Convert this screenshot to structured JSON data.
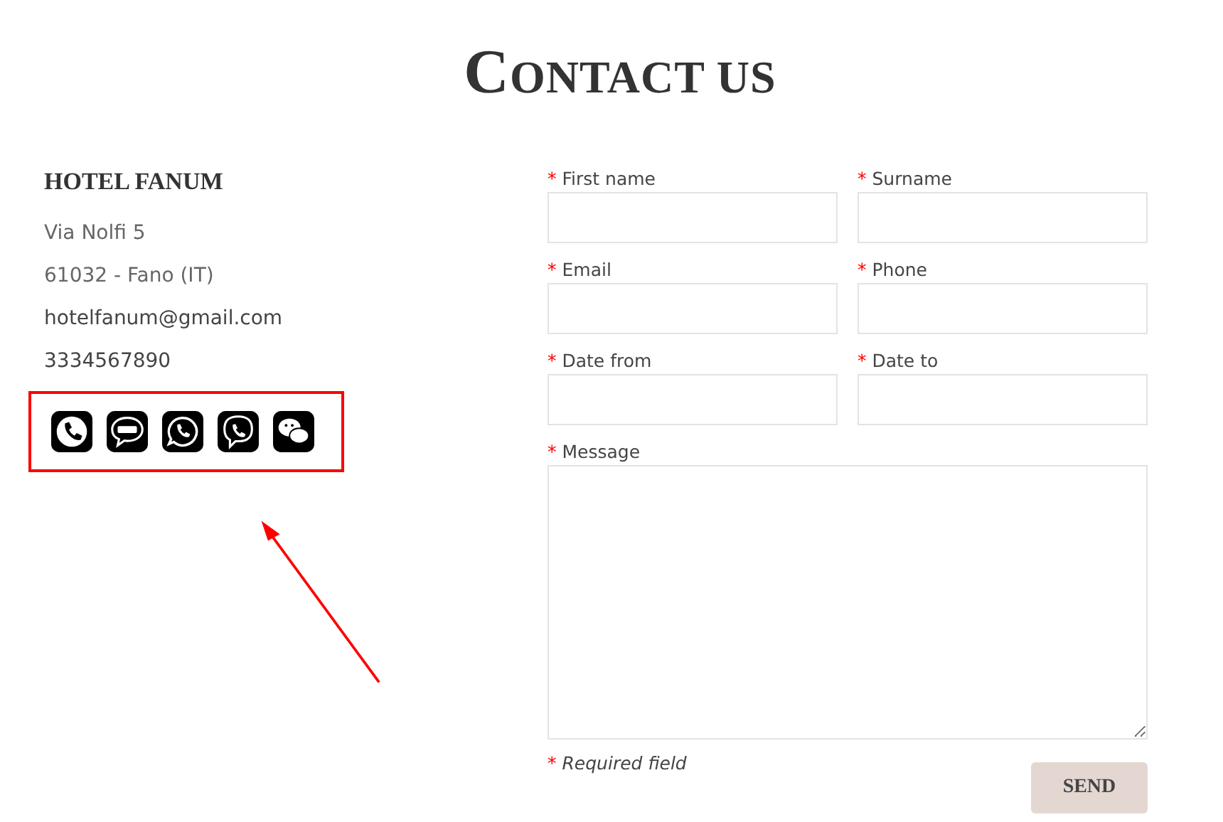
{
  "title": "CONTACT US",
  "hotel": {
    "name": "HOTEL FANUM",
    "address_lines": [
      "Via Nolfi 5",
      "61032 - Fano (IT)"
    ],
    "email": "hotelfanum@gmail.com",
    "phone": "3334567890",
    "contact_icons": [
      {
        "kind": "phone"
      },
      {
        "kind": "sms"
      },
      {
        "kind": "whatsapp"
      },
      {
        "kind": "viber"
      },
      {
        "kind": "wechat"
      }
    ]
  },
  "annotation": {
    "kind": "highlight-arrow"
  },
  "form": {
    "fields": [
      {
        "label": "First name",
        "mark": "*",
        "kind": "input"
      },
      {
        "label": "Surname",
        "mark": "*",
        "kind": "input"
      },
      {
        "label": "Email",
        "mark": "*",
        "kind": "input"
      },
      {
        "label": "Phone",
        "mark": "*",
        "kind": "input"
      },
      {
        "label": "Date from",
        "mark": "*",
        "kind": "input"
      },
      {
        "label": "Date to",
        "mark": "*",
        "kind": "input"
      },
      {
        "label": "Message",
        "mark": "*",
        "kind": "textarea"
      }
    ],
    "note": {
      "mark": "*",
      "text": "Required field"
    },
    "submit": "SEND"
  }
}
